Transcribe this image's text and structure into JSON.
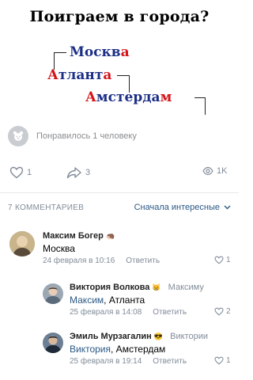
{
  "post": {
    "title": "Поиграем в города?",
    "cities": [
      {
        "main": "Москв",
        "tail": "а"
      },
      {
        "head": "А",
        "main": "тлант",
        "tail": "а"
      },
      {
        "head": "А",
        "main": "мстерда",
        "tail": "м"
      }
    ],
    "liked_text": "Понравилось 1 человеку"
  },
  "actions": {
    "likes": "1",
    "shares": "3",
    "views": "1K"
  },
  "comments_header": {
    "count_label": "7 КОММЕНТАРИЕВ",
    "sort_label": "Сначала интересные"
  },
  "comments": [
    {
      "name": "Максим Богер",
      "text": "Москва",
      "date": "24 февраля в 10:16",
      "reply_label": "Ответить",
      "likes": "1"
    },
    {
      "name": "Виктория Волкова",
      "reply_to": "Максиму",
      "mention": "Максим",
      "text_after": ", Атланта",
      "date": "25 февраля в 14:08",
      "reply_label": "Ответить",
      "likes": "2"
    },
    {
      "name": "Эмиль Мурзагалин",
      "reply_to": "Виктории",
      "mention": "Виктория",
      "text_after": ", Амстердам",
      "date": "25 февраля в 19:14",
      "reply_label": "Ответить",
      "likes": "1"
    }
  ],
  "colors": {
    "link": "#2a5885",
    "meta": "#818c99",
    "city_blue": "#1c2f86",
    "city_red": "#d3151a"
  }
}
